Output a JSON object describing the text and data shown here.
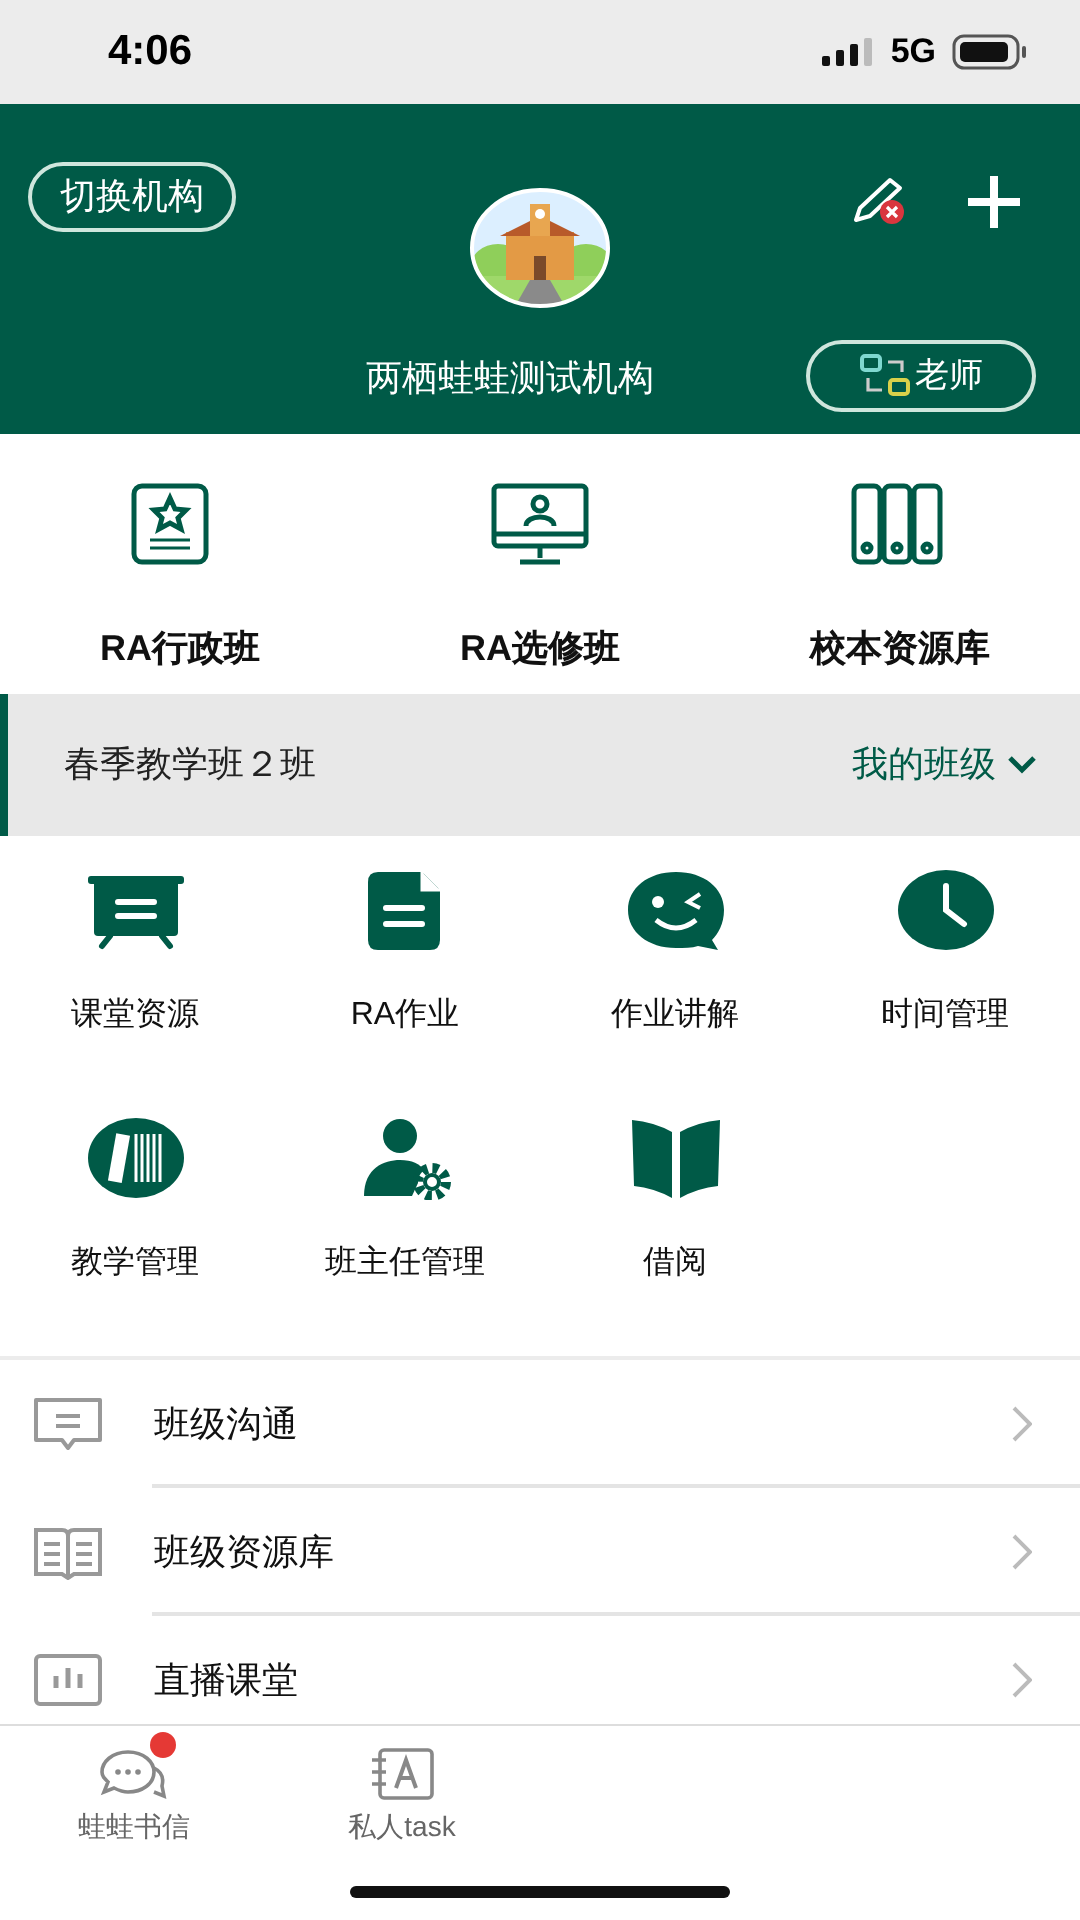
{
  "status_bar": {
    "time": "4:06",
    "network": "5G"
  },
  "header": {
    "switch_button": "切换机构",
    "org_name": "两栖蛙蛙测试机构",
    "role_button": "老师"
  },
  "quick_links": [
    {
      "label": "RA行政班"
    },
    {
      "label": "RA选修班"
    },
    {
      "label": "校本资源库"
    }
  ],
  "class_bar": {
    "class_name": "春季教学班２班",
    "my_classes": "我的班级"
  },
  "features": [
    {
      "label": "课堂资源"
    },
    {
      "label": "RA作业"
    },
    {
      "label": "作业讲解"
    },
    {
      "label": "时间管理"
    },
    {
      "label": "教学管理"
    },
    {
      "label": "班主任管理"
    },
    {
      "label": "借阅"
    }
  ],
  "menu": [
    {
      "label": "班级沟通"
    },
    {
      "label": "班级资源库"
    },
    {
      "label": "直播课堂"
    }
  ],
  "tab_bar": [
    {
      "label": "蛙蛙书信",
      "badge": true
    },
    {
      "label": "私人task",
      "badge": false
    }
  ]
}
